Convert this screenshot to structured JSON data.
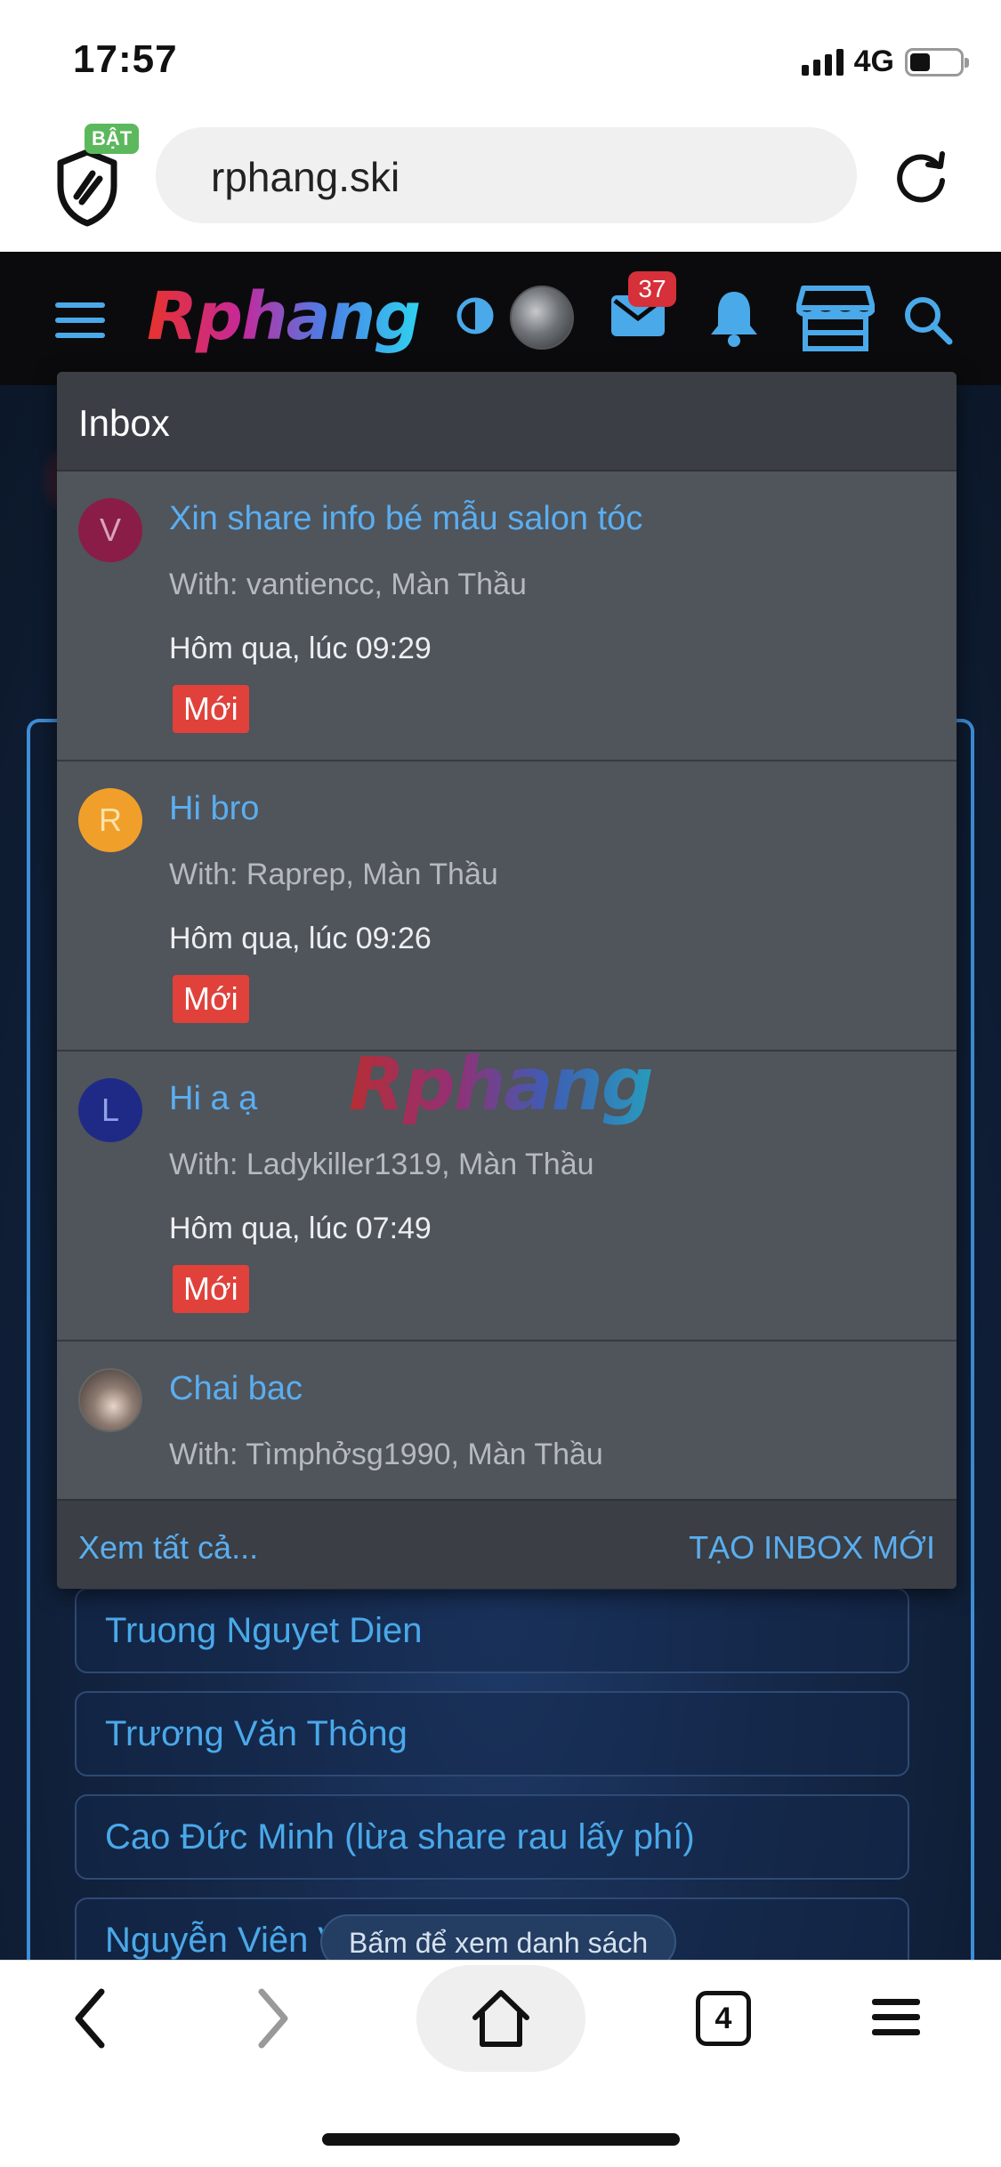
{
  "status_bar": {
    "time": "17:57",
    "network": "4G"
  },
  "browser": {
    "shield_badge": "BẬT",
    "url": "rphang.ski",
    "tabs_count": "4"
  },
  "site_header": {
    "logo_text": "Rphang",
    "mail_badge": "37"
  },
  "inbox": {
    "title": "Inbox",
    "conversations": [
      {
        "avatar_letter": "V",
        "avatar_color": "#8a1c48",
        "avatar_text_color": "#d9a2bd",
        "title": "Xin share info bé mẫu salon tóc",
        "with": "With: vantiencc, Màn Thầu",
        "time": "Hôm qua, lúc 09:29",
        "badge": "Mới"
      },
      {
        "avatar_letter": "R",
        "avatar_color": "#f0a02a",
        "avatar_text_color": "#fbe2a8",
        "title": "Hi bro",
        "with": "With: Raprep, Màn Thầu",
        "time": "Hôm qua, lúc 09:26",
        "badge": "Mới"
      },
      {
        "avatar_letter": "L",
        "avatar_color": "#1e2a86",
        "avatar_text_color": "#8ea2ea",
        "title": "Hi a ạ",
        "with": "With: Ladykiller1319, Màn Thầu",
        "time": "Hôm qua, lúc 07:49",
        "badge": "Mới"
      },
      {
        "avatar_letter": "",
        "title": "Chai bac",
        "with": "With: Tìmphởsg1990, Màn Thầu"
      }
    ],
    "watermark": "Rphang",
    "see_all": "Xem tất cả...",
    "new_inbox": "TẠO INBOX MỚI"
  },
  "background_list": {
    "items": [
      "Truong Nguyet Dien",
      "Trương Văn Thông",
      "Cao Đức Minh (lừa share rau lấy phí)",
      "Nguyễn Viên V"
    ],
    "floating_pill": "Bấm để xem danh sách"
  },
  "colors": {
    "accent_blue": "#4aa9e9",
    "badge_red": "#e0423b",
    "inbox_bg": "#4a4e55"
  }
}
